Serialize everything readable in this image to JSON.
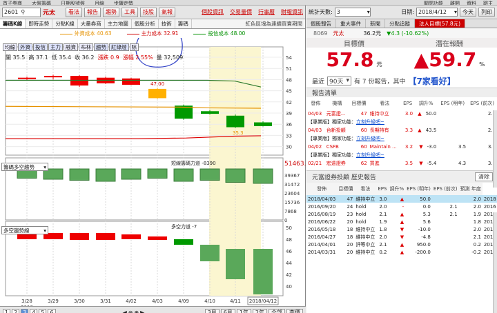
{
  "topstrip": {
    "left": [
      "首子券商",
      "大盤籌碼",
      "日期股號盤",
      "月線",
      "步驟走勢"
    ],
    "right": [
      "關閉功能",
      "離開",
      "資料",
      "跳主"
    ]
  },
  "left": {
    "code": "2601",
    "name": "元太",
    "buttons": [
      "看法",
      "報告",
      "趨勢",
      "工具",
      "技股",
      "氣報"
    ],
    "links": [
      "個股資訊",
      "交易量價",
      "行事曆",
      "財報資訊"
    ],
    "tabs": [
      "籌碼K線",
      "即時走勢",
      "分點K線",
      "大量券商",
      "主力地圖",
      "個股分析",
      "技術",
      "籌碼"
    ],
    "tab_hint": "紅色區塊為連續買賣期間",
    "legend": [
      {
        "label": "外資成本 40.63",
        "color": "#e69200"
      },
      {
        "label": "主力成本 32.91",
        "color": "#d00000"
      },
      {
        "label": "投信成本 48.00",
        "color": "#009000"
      }
    ],
    "tools": [
      "均線",
      "外資",
      "投信",
      "主力",
      "融資",
      "布林",
      "趨勢",
      "紅綠燈",
      "除"
    ],
    "ohlc": {
      "open": "開 35.5",
      "high": "高 37.1",
      "low": "低 35.4",
      "close": "收 36.2",
      "chg": "漲跌 0.9",
      "pct": "漲幅 2.55%",
      "vol": "量 32,509"
    },
    "price_labels": {
      "high": "47.00",
      "low": "35.3"
    },
    "y1": [
      "54",
      "51",
      "48",
      "45",
      "42",
      "39",
      "36",
      "33",
      "30"
    ],
    "ind1": {
      "label": "籌碼多空趨勢",
      "title": "短線籌碼力道 -8390",
      "value": "51463.",
      "ticks": [
        "39367",
        "31472",
        "23604",
        "15736",
        "7868",
        "0"
      ]
    },
    "ind2": {
      "label": "多空趨勢線",
      "title": "多空力道 -7",
      "ticks": [
        "50",
        "48",
        "46",
        "44",
        "42",
        "40"
      ]
    },
    "x": [
      "3/28",
      "3/29",
      "3/30",
      "3/31",
      "4/02",
      "4/03",
      "4/09",
      "4/10",
      "4/11",
      "2018/04/12"
    ],
    "x_year": "2018",
    "pages": [
      "1",
      "2",
      "3",
      "4",
      "5",
      "6"
    ],
    "ranges": [
      "3月",
      "6月",
      "1年",
      "2年",
      "全部",
      "查價"
    ]
  },
  "right": {
    "days_label": "統計天數:",
    "days": "3",
    "date_label": "日期:",
    "date": "2018/4/12",
    "today": "今天",
    "print": "列印",
    "tabs": [
      "個股報告",
      "重大事件",
      "新聞",
      "分點追蹤",
      "法人目標(57.8元)"
    ],
    "quote": {
      "code": "8069",
      "name": "元太",
      "price": "36.2元",
      "chg": "▼4.3 (-10.62%)"
    },
    "hdr": [
      "目標價",
      "潛在報酬"
    ],
    "target": "57.8",
    "target_unit": "元",
    "upside": "▲59.7",
    "upside_unit": "%",
    "recent": {
      "pre": "最近",
      "dd": "90天",
      "mid": "有 7 份報告，其中",
      "seven": "【7家看好】"
    },
    "list_title": "報告清單",
    "cols1": [
      "發佈",
      "機構",
      "目標價",
      "看法",
      "EPS",
      "調升%",
      "EPS (明年)",
      "EPS (前次)"
    ],
    "rows1": [
      {
        "t": "row",
        "d": "04/03",
        "b": "元富證...",
        "tp": "47",
        "v": "維持中立",
        "eps": "3.0",
        "dir": "▲",
        "up": "50.0",
        "e2": "",
        "e3": "2.0"
      },
      {
        "t": "promo",
        "a": "【專業版】獨家功能：",
        "b": "立刻升級吧~"
      },
      {
        "t": "row",
        "d": "04/03",
        "b": "台新投顧",
        "tp": "60",
        "v": "長期持有",
        "eps": "3.3",
        "dir": "▲",
        "up": "43.5",
        "e2": "",
        "e3": "2.3"
      },
      {
        "t": "promo",
        "a": "【專業版】獨家功能：",
        "b": "立刻升級吧~"
      },
      {
        "t": "row",
        "d": "04/02",
        "b": "CSFB",
        "tp": "60",
        "v": "Maintain ...",
        "eps": "3.2",
        "dir": "▼",
        "up": "-3.0",
        "e2": "3.5",
        "e3": "3.3"
      },
      {
        "t": "promo",
        "a": "【專業版】獨家功能：",
        "b": "立刻升級吧~"
      },
      {
        "t": "row",
        "d": "02/21",
        "b": "宏遠證券",
        "tp": "62",
        "v": "買進",
        "eps": "3.5",
        "dir": "▼",
        "up": "-5.4",
        "e2": "4.3",
        "e3": "3.7"
      }
    ],
    "hist_title": "元富證券投顧 歷史報告",
    "clear": "清除",
    "cols2": [
      "發佈",
      "目標價",
      "看法",
      "EPS",
      "調升%",
      "EPS (明年)",
      "EPS (前次)",
      "預測 年度"
    ],
    "rows2": [
      [
        "2018/04/03",
        "47",
        "維持中立",
        "3.0",
        "▲",
        "50.0",
        "",
        "2.0",
        "2018"
      ],
      [
        "2016/09/20",
        "24",
        "hold",
        "2.0",
        "-",
        "0.0",
        "2.1",
        "2.0",
        "2016"
      ],
      [
        "2016/08/19",
        "23",
        "hold",
        "2.1",
        "▲",
        "5.3",
        "2.1",
        "1.9",
        "2016"
      ],
      [
        "2016/06/22",
        "20",
        "hold",
        "1.9",
        "▲",
        "5.6",
        "",
        "1.8",
        "2016"
      ],
      [
        "2016/05/18",
        "18",
        "維持中立",
        "1.8",
        "▼",
        "-10.0",
        "",
        "2.0",
        "2016"
      ],
      [
        "2016/04/27",
        "18",
        "維持中立",
        "2.0",
        "▼",
        "-4.8",
        "",
        "2.1",
        "2016"
      ],
      [
        "2014/04/01",
        "20",
        "評等中立",
        "2.1",
        "▲",
        "950.0",
        "",
        "0.2",
        "2014"
      ],
      [
        "2014/03/31",
        "20",
        "維持中立",
        "0.2",
        "▲",
        "-200.0",
        "",
        "-0.2",
        "2014"
      ]
    ]
  }
}
